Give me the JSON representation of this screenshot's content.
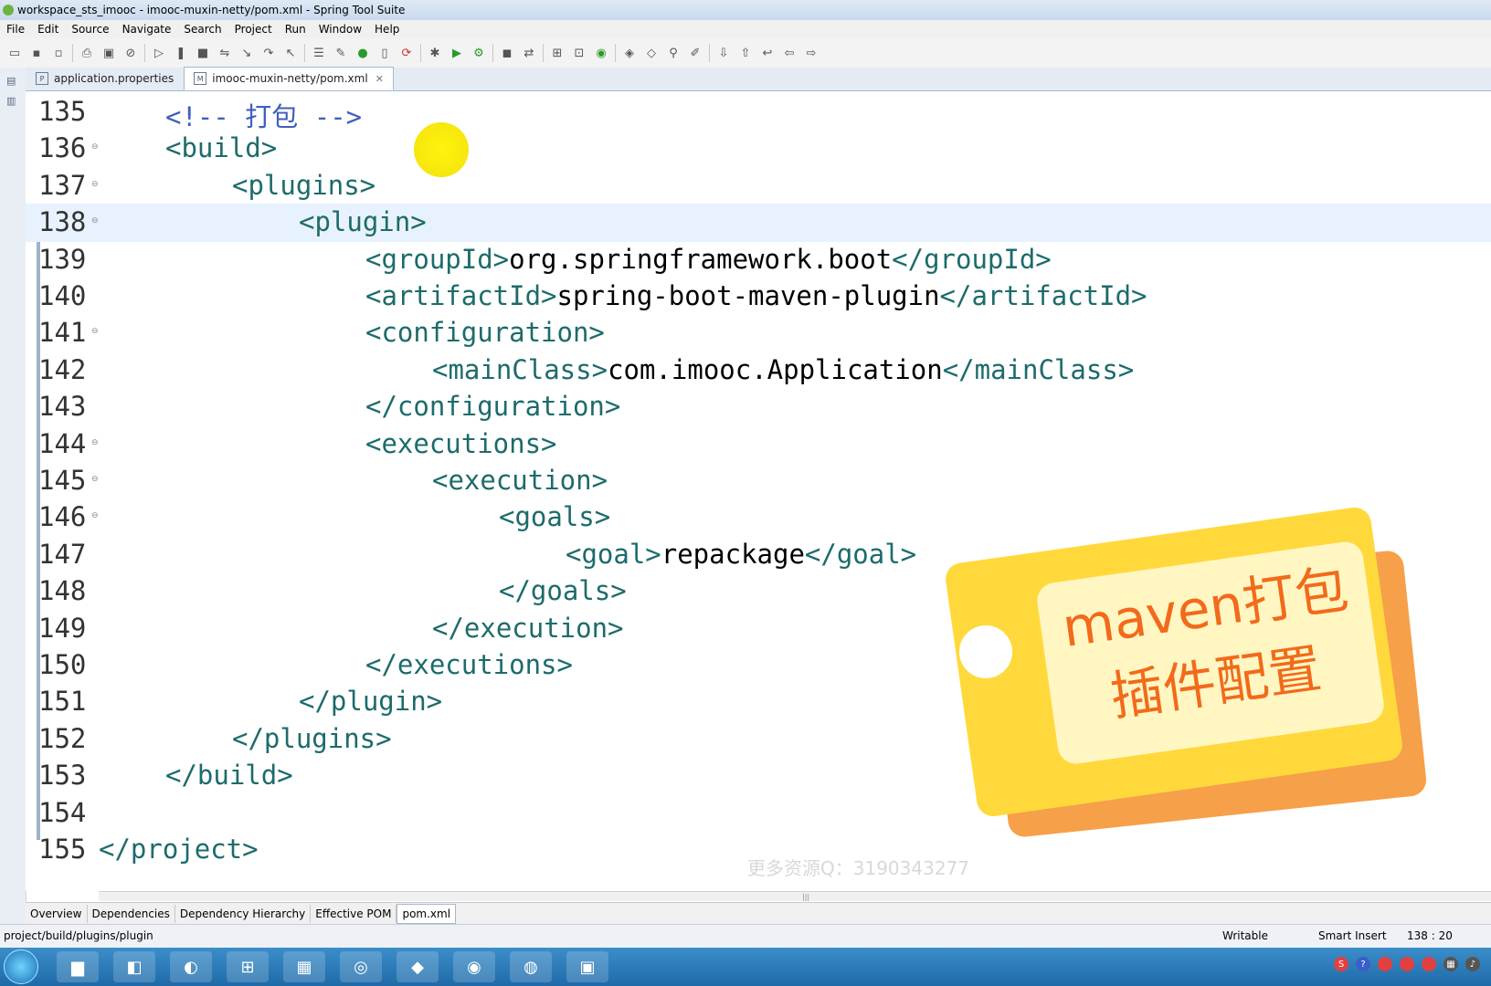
{
  "window": {
    "title": "workspace_sts_imooc - imooc-muxin-netty/pom.xml - Spring Tool Suite"
  },
  "menu": [
    "File",
    "Edit",
    "Source",
    "Navigate",
    "Search",
    "Project",
    "Run",
    "Window",
    "Help"
  ],
  "editor_tabs": [
    {
      "label": "application.properties",
      "icon": "properties-file-icon",
      "active": false
    },
    {
      "label": "imooc-muxin-netty/pom.xml",
      "icon": "maven-file-icon",
      "active": true
    }
  ],
  "code_lines": [
    {
      "num": "135",
      "fold": false,
      "indent": 1,
      "parts": [
        {
          "t": "<!-- 打包 -->",
          "c": "cmt"
        }
      ]
    },
    {
      "num": "136",
      "fold": true,
      "indent": 1,
      "parts": [
        {
          "t": "<build>",
          "c": "tag"
        }
      ]
    },
    {
      "num": "137",
      "fold": true,
      "indent": 2,
      "parts": [
        {
          "t": "<plugins>",
          "c": "tag"
        }
      ]
    },
    {
      "num": "138",
      "fold": true,
      "indent": 3,
      "current": true,
      "parts": [
        {
          "t": "<plugin>",
          "c": "tag"
        }
      ]
    },
    {
      "num": "139",
      "fold": false,
      "indent": 4,
      "parts": [
        {
          "t": "<groupId>",
          "c": "tag"
        },
        {
          "t": "org.springframework.boot",
          "c": "val"
        },
        {
          "t": "</groupId>",
          "c": "tag"
        }
      ]
    },
    {
      "num": "140",
      "fold": false,
      "indent": 4,
      "parts": [
        {
          "t": "<artifactId>",
          "c": "tag"
        },
        {
          "t": "spring-boot-maven-plugin",
          "c": "val"
        },
        {
          "t": "</artifactId>",
          "c": "tag"
        }
      ]
    },
    {
      "num": "141",
      "fold": true,
      "indent": 4,
      "parts": [
        {
          "t": "<configuration>",
          "c": "tag"
        }
      ]
    },
    {
      "num": "142",
      "fold": false,
      "indent": 5,
      "parts": [
        {
          "t": "<mainClass>",
          "c": "tag"
        },
        {
          "t": "com.imooc.Application",
          "c": "val"
        },
        {
          "t": "</mainClass>",
          "c": "tag"
        }
      ]
    },
    {
      "num": "143",
      "fold": false,
      "indent": 4,
      "parts": [
        {
          "t": "</configuration>",
          "c": "tag"
        }
      ]
    },
    {
      "num": "144",
      "fold": true,
      "indent": 4,
      "parts": [
        {
          "t": "<executions>",
          "c": "tag"
        }
      ]
    },
    {
      "num": "145",
      "fold": true,
      "indent": 5,
      "parts": [
        {
          "t": "<execution>",
          "c": "tag"
        }
      ]
    },
    {
      "num": "146",
      "fold": true,
      "indent": 6,
      "parts": [
        {
          "t": "<goals>",
          "c": "tag"
        }
      ]
    },
    {
      "num": "147",
      "fold": false,
      "indent": 7,
      "parts": [
        {
          "t": "<goal>",
          "c": "tag"
        },
        {
          "t": "repackage",
          "c": "val"
        },
        {
          "t": "</goal>",
          "c": "tag"
        }
      ]
    },
    {
      "num": "148",
      "fold": false,
      "indent": 6,
      "parts": [
        {
          "t": "</goals>",
          "c": "tag"
        }
      ]
    },
    {
      "num": "149",
      "fold": false,
      "indent": 5,
      "parts": [
        {
          "t": "</execution>",
          "c": "tag"
        }
      ]
    },
    {
      "num": "150",
      "fold": false,
      "indent": 4,
      "parts": [
        {
          "t": "</executions>",
          "c": "tag"
        }
      ]
    },
    {
      "num": "151",
      "fold": false,
      "indent": 3,
      "parts": [
        {
          "t": "</plugin>",
          "c": "tag"
        }
      ]
    },
    {
      "num": "152",
      "fold": false,
      "indent": 2,
      "parts": [
        {
          "t": "</plugins>",
          "c": "tag"
        }
      ]
    },
    {
      "num": "153",
      "fold": false,
      "indent": 1,
      "parts": [
        {
          "t": "</build>",
          "c": "tag"
        }
      ]
    },
    {
      "num": "154",
      "fold": false,
      "indent": 0,
      "parts": []
    },
    {
      "num": "155",
      "fold": false,
      "indent": 0,
      "parts": [
        {
          "t": "</project>",
          "c": "tag"
        }
      ]
    }
  ],
  "sticker": {
    "line1": "maven打包",
    "line2": "插件配置"
  },
  "watermark": "更多资源Q：3190343277",
  "pom_tabs": [
    {
      "label": "Overview",
      "active": false
    },
    {
      "label": "Dependencies",
      "active": false
    },
    {
      "label": "Dependency Hierarchy",
      "active": false
    },
    {
      "label": "Effective POM",
      "active": false
    },
    {
      "label": "pom.xml",
      "active": true
    }
  ],
  "status": {
    "path": "project/build/plugins/plugin",
    "mode": "Writable",
    "insert": "Smart Insert",
    "position": "138 : 20"
  },
  "colors": {
    "tag": "#1d6b6b",
    "comment": "#3f5fbf",
    "current_line": "#e8f2fe",
    "sticker": "#ffd93b",
    "sticker_text": "#f26a1b"
  }
}
